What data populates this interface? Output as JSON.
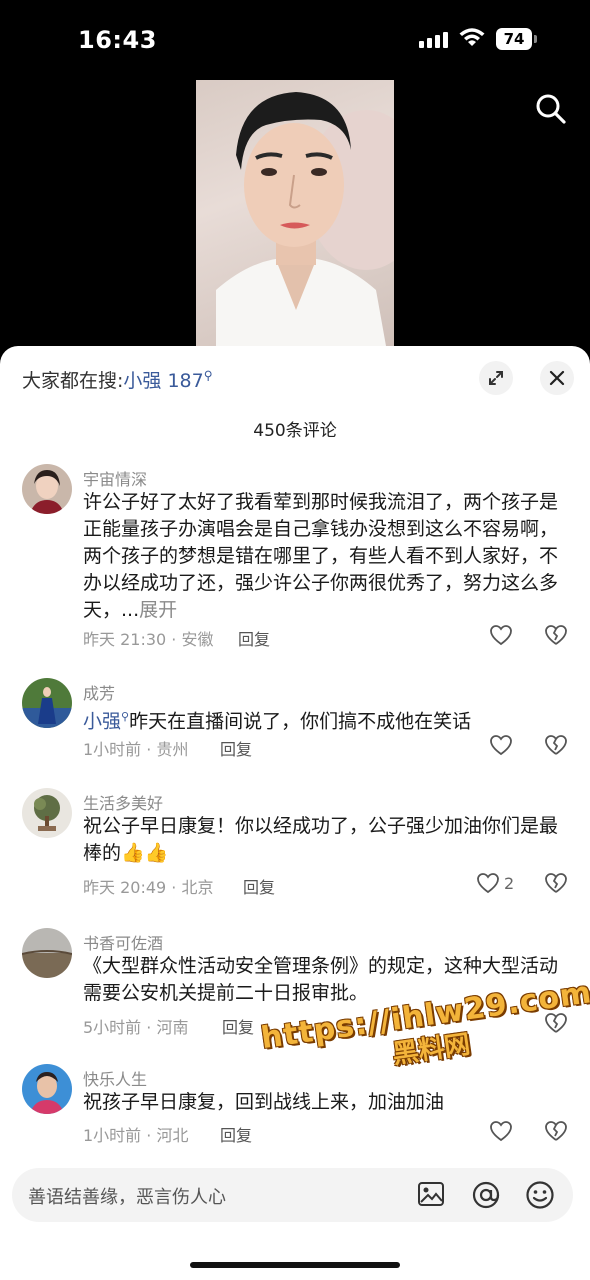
{
  "status_bar": {
    "time": "16:43",
    "battery": "74"
  },
  "panel": {
    "hot_search_label": "大家都在搜:",
    "hot_search_keyword": "小强 187",
    "comment_count": "450条评论"
  },
  "comments": [
    {
      "name": "宇宙情深",
      "text": "许公子好了太好了我看荤到那时候我流泪了，两个孩子是正能量孩子办演唱会是自己拿钱办没想到这么不容易啊，两个孩子的梦想是错在哪里了，有些人看不到人家好，不办以经成功了还，强少许公子你两很优秀了，努力这么多天，...",
      "more": "展开",
      "meta": "昨天 21:30 · 安徽",
      "reply": "回复",
      "likes": ""
    },
    {
      "name": "成芳",
      "mention": "小强",
      "text": "昨天在直播间说了，你们搞不成他在笑话",
      "meta": "1小时前 · 贵州",
      "reply": "回复",
      "likes": ""
    },
    {
      "name": "生活多美好",
      "text": "祝公子早日康复！你以经成功了，公子强少加油你们是最棒的👍👍",
      "meta": "昨天 20:49 · 北京",
      "reply": "回复",
      "likes": "2"
    },
    {
      "name": "书香可佐酒",
      "text": "《大型群众性活动安全管理条例》的规定，这种大型活动需要公安机关提前二十日报审批。",
      "meta": "5小时前 · 河南",
      "reply": "回复",
      "likes": ""
    },
    {
      "name": "快乐人生",
      "text": "祝孩子早日康复，回到战线上来，加油加油",
      "meta": "1小时前 · 河北",
      "reply": "回复",
      "likes": ""
    }
  ],
  "input": {
    "placeholder": "善语结善缘，恶言伤人心"
  },
  "watermark": {
    "url": "https://ihlw29.com",
    "text": "黑料网"
  },
  "icons": [
    "search-icon",
    "expand-icon",
    "close-icon",
    "heart-icon",
    "broken-heart-icon",
    "image-icon",
    "at-icon",
    "emoji-icon"
  ]
}
